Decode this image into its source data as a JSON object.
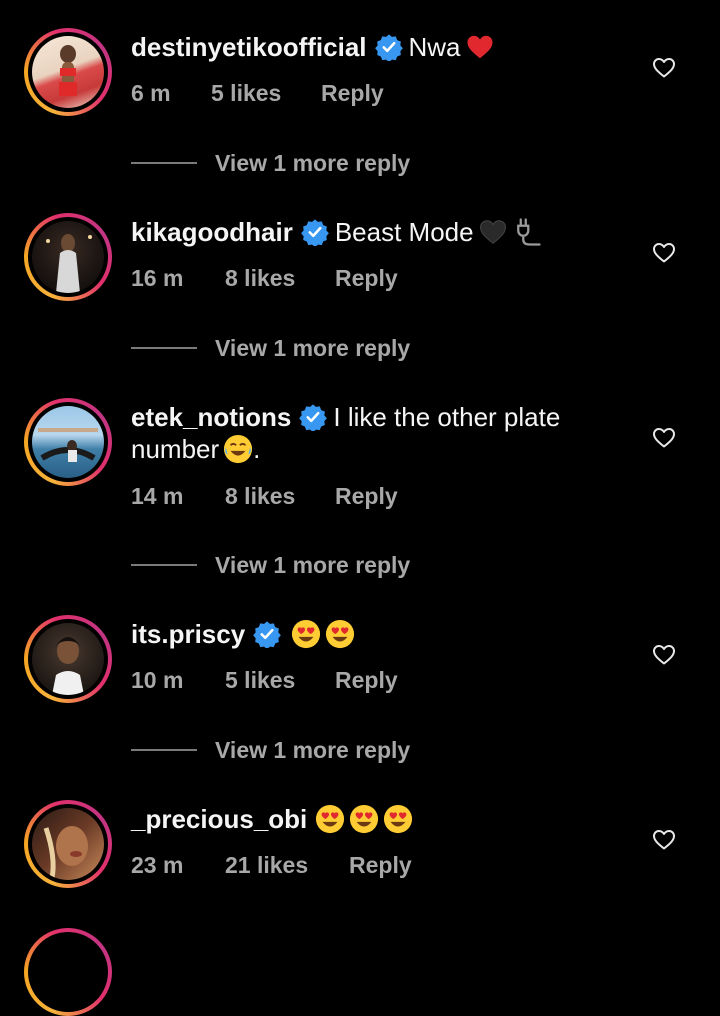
{
  "comments": [
    {
      "username": "destinyetikoofficial",
      "text": "Nwa",
      "time": "6 m",
      "likes": "5 likes",
      "reply": "Reply",
      "more": "View 1 more reply"
    },
    {
      "username": "kikagoodhair",
      "text": "Beast Mode",
      "time": "16 m",
      "likes": "8 likes",
      "reply": "Reply",
      "more": "View 1 more reply"
    },
    {
      "username": "etek_notions",
      "text": "I like the other plate number",
      "text_tail": ".",
      "time": "14 m",
      "likes": "8 likes",
      "reply": "Reply",
      "more": "View 1 more reply"
    },
    {
      "username": "its.priscy",
      "text": "",
      "time": "10 m",
      "likes": "5 likes",
      "reply": "Reply",
      "more": "View 1 more reply"
    },
    {
      "username": "_precious_obi",
      "text": "",
      "time": "23 m",
      "likes": "21 likes",
      "reply": "Reply"
    }
  ],
  "icons": {
    "verified": "verified-badge-icon",
    "like": "heart-outline-icon"
  },
  "colors": {
    "background": "#000000",
    "text": "#f5f5f5",
    "muted": "#a8a8a8",
    "verified": "#3897f0",
    "heart_red": "#e0282e"
  }
}
